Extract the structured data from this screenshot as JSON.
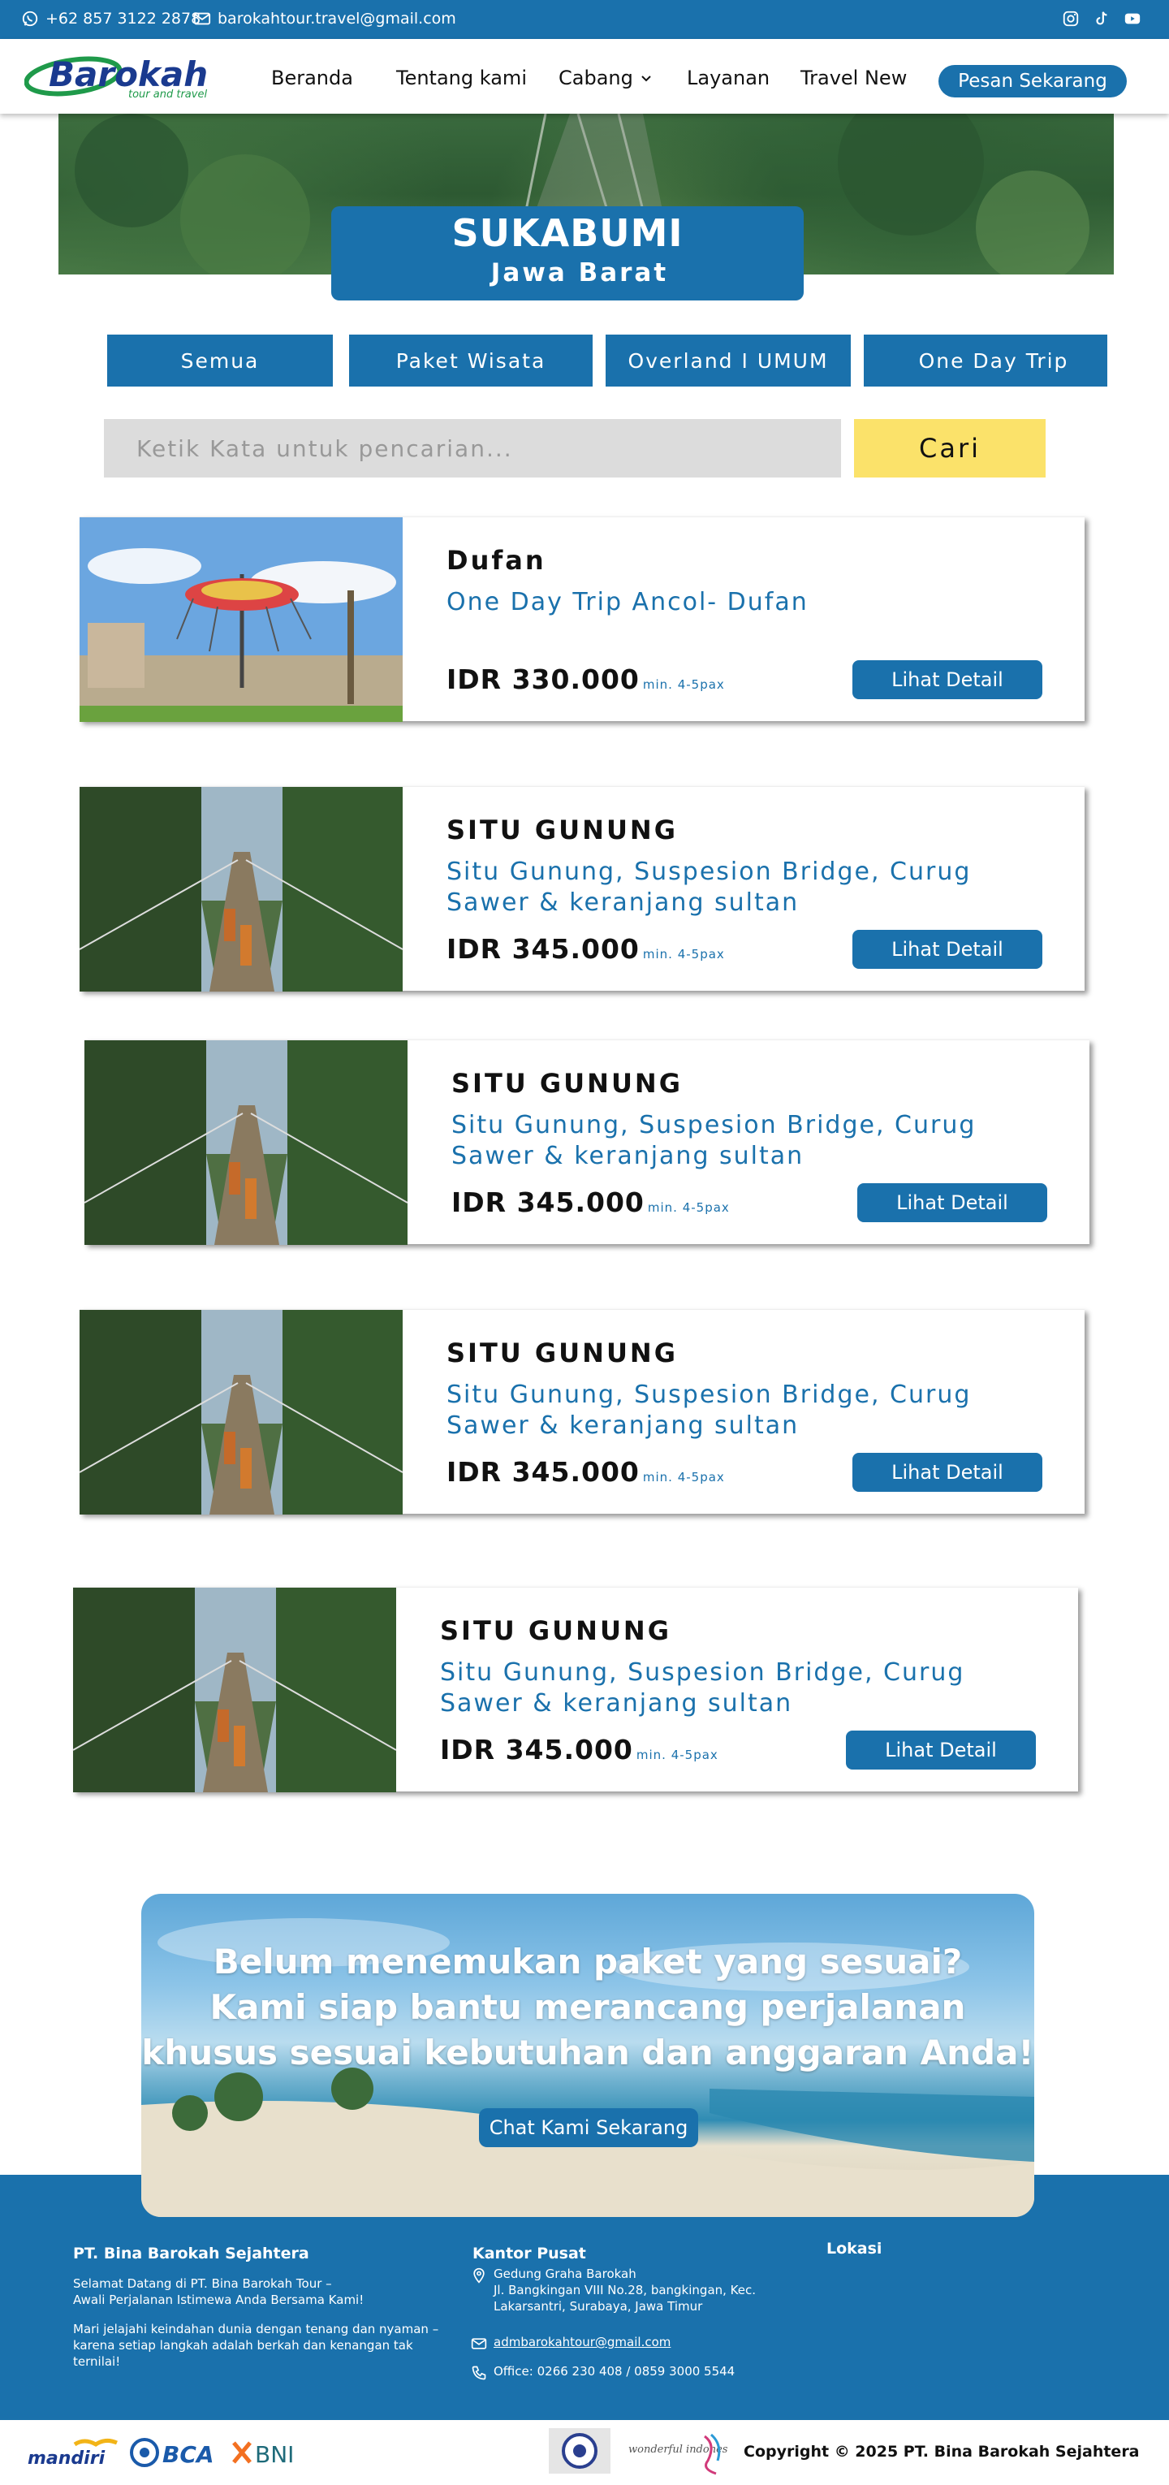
{
  "topbar": {
    "phone": "+62 857 3122 2878",
    "email": "barokahtour.travel@gmail.com",
    "social_icons": [
      "instagram-icon",
      "tiktok-icon",
      "youtube-icon"
    ]
  },
  "navbar": {
    "logo_text": "Barokah",
    "logo_tagline": "tour and travel",
    "links": [
      "Beranda",
      "Tentang kami",
      "Cabang",
      "Layanan",
      "Travel New"
    ],
    "cta_label": "Pesan Sekarang"
  },
  "hero": {
    "title": "SUKABUMI",
    "subtitle": "Jawa Barat"
  },
  "tabs": [
    "Semua",
    "Paket Wisata",
    "Overland I UMUM",
    "One Day Trip"
  ],
  "search": {
    "placeholder": "Ketik Kata untuk pencarian...",
    "button_label": "Cari"
  },
  "cards": [
    {
      "title": "Dufan",
      "desc": "One Day Trip Ancol- Dufan",
      "price": "IDR 330.000",
      "min": "min. 4-5pax",
      "button": "Lihat Detail",
      "image": "amusement-park-photo"
    },
    {
      "title": "SITU GUNUNG",
      "desc": "Situ Gunung, Suspesion Bridge, Curug Sawer & keranjang sultan",
      "price": "IDR 345.000",
      "min": "min. 4-5pax",
      "button": "Lihat Detail",
      "image": "suspension-bridge-photo"
    },
    {
      "title": "SITU GUNUNG",
      "desc": "Situ Gunung, Suspesion Bridge, Curug Sawer & keranjang sultan",
      "price": "IDR 345.000",
      "min": "min. 4-5pax",
      "button": "Lihat Detail",
      "image": "suspension-bridge-photo"
    },
    {
      "title": "SITU GUNUNG",
      "desc": "Situ Gunung, Suspesion Bridge, Curug Sawer & keranjang sultan",
      "price": "IDR 345.000",
      "min": "min. 4-5pax",
      "button": "Lihat Detail",
      "image": "suspension-bridge-photo"
    },
    {
      "title": "SITU GUNUNG",
      "desc": "Situ Gunung, Suspesion Bridge, Curug Sawer & keranjang sultan",
      "price": "IDR 345.000",
      "min": "min. 4-5pax",
      "button": "Lihat Detail",
      "image": "suspension-bridge-photo"
    }
  ],
  "cta": {
    "line1": "Belum menemukan paket yang sesuai?",
    "line2": "Kami siap bantu merancang perjalanan",
    "line3": "khusus sesuai kebutuhan dan anggaran Anda!",
    "button": "Chat Kami Sekarang"
  },
  "footer": {
    "company": "PT. Bina Barokah Sejahtera",
    "about1": "Selamat Datang di PT. Bina Barokah Tour –",
    "about2": "Awali Perjalanan Istimewa Anda Bersama Kami!",
    "about3": "Mari jelajahi keindahan dunia dengan tenang dan nyaman –",
    "about4": "karena setiap langkah adalah berkah dan kenangan tak",
    "about5": "ternilai!",
    "office_heading": "Kantor Pusat",
    "address1": "Gedung Graha Barokah",
    "address2": "Jl. Bangkingan VIII No.28, bangkingan, Kec.",
    "address3": "Lakarsantri, Surabaya, Jawa Timur",
    "email": "admbarokahtour@gmail.com",
    "phone": "Office: 0266 230 408 / 0859 3000 5544",
    "location_heading": "Lokasi"
  },
  "bottom": {
    "partners": [
      "mandiri",
      "BCA",
      "BNI"
    ],
    "badge_text": "wonderful indonesia",
    "copyright": "Copyright © 2025 PT. Bina Barokah Sejahtera"
  },
  "colors": {
    "brand_blue": "#1a71ac",
    "search_yellow": "#fbe26a",
    "logo_green": "#1f9a4a"
  }
}
